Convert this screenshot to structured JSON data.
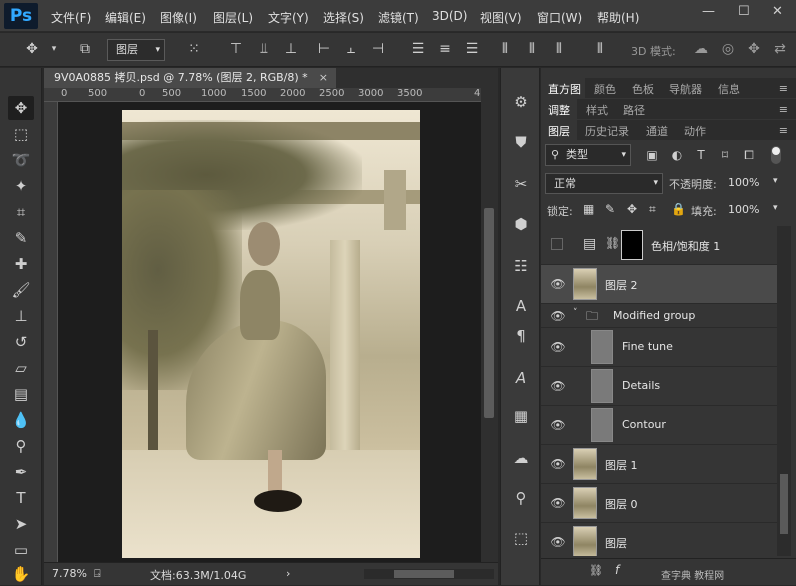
{
  "app": {
    "logo": "Ps"
  },
  "menu": [
    "文件(F)",
    "编辑(E)",
    "图像(I)",
    "图层(L)",
    "文字(Y)",
    "选择(S)",
    "滤镜(T)",
    "3D(D)",
    "视图(V)",
    "窗口(W)",
    "帮助(H)"
  ],
  "window_controls": {
    "minimize": "—",
    "restore": "☐",
    "close": "✕"
  },
  "options_bar": {
    "auto_select_value": "图层",
    "mode_3d_label": "3D 模式:"
  },
  "document": {
    "tab_title": "9V0A0885 拷贝.psd @ 7.78% (图层 2, RGB/8) *",
    "tab_close": "×",
    "ruler_labels": [
      "0",
      "500",
      "0",
      "500",
      "1000",
      "1500",
      "2000",
      "2500",
      "3000",
      "3500",
      "4"
    ]
  },
  "status": {
    "zoom": "7.78%",
    "doc_info": "文档:63.3M/1.04G",
    "arrow": "›"
  },
  "panels": {
    "row1_tabs": [
      "直方图",
      "颜色",
      "色板",
      "导航器",
      "信息"
    ],
    "row2_tabs": [
      "调整",
      "样式",
      "路径"
    ],
    "row3_tabs": [
      "图层",
      "历史记录",
      "通道",
      "动作"
    ],
    "filter_label": "类型",
    "blend_mode": "正常",
    "opacity_label": "不透明度:",
    "opacity_value": "100%",
    "lock_label": "锁定:",
    "fill_label": "填充:",
    "fill_value": "100%"
  },
  "layers": [
    {
      "name": "色相/饱和度 1",
      "type": "adjustment",
      "visible": false,
      "selected": false
    },
    {
      "name": "图层 2",
      "type": "photo",
      "visible": true,
      "selected": true
    },
    {
      "name": "Modified group",
      "type": "group",
      "visible": true,
      "selected": false
    },
    {
      "name": "Fine tune",
      "type": "gray",
      "visible": true,
      "selected": false
    },
    {
      "name": "Details",
      "type": "gray",
      "visible": true,
      "selected": false
    },
    {
      "name": "Contour",
      "type": "gray",
      "visible": true,
      "selected": false
    },
    {
      "name": "图层 1",
      "type": "photo",
      "visible": true,
      "selected": false
    },
    {
      "name": "图层 0",
      "type": "photo",
      "visible": true,
      "selected": false
    },
    {
      "name": "图层",
      "type": "photo",
      "visible": true,
      "selected": false
    }
  ],
  "watermark": "查字典 教程网"
}
